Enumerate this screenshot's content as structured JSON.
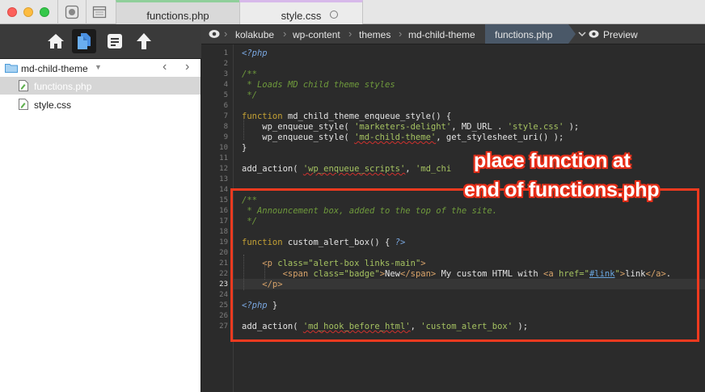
{
  "window": {
    "tabs": [
      {
        "label": "functions.php",
        "active": true,
        "color": "#8fcf9a"
      },
      {
        "label": "style.css",
        "active": false,
        "color": "#d7b9ea"
      }
    ]
  },
  "toolbar": {
    "icons": [
      "home-icon",
      "files-icon",
      "document-icon",
      "upload-arrow-icon"
    ]
  },
  "sidebar": {
    "project": "md-child-theme",
    "files": [
      {
        "label": "functions.php",
        "selected": true
      },
      {
        "label": "style.css",
        "selected": false
      }
    ]
  },
  "breadcrumb": {
    "items": [
      "kolakube",
      "wp-content",
      "themes",
      "md-child-theme",
      "functions.php"
    ],
    "preview_label": "Preview"
  },
  "editor": {
    "active_line": 23,
    "lines": [
      {
        "n": "1"
      },
      {
        "n": "2"
      },
      {
        "n": "3"
      },
      {
        "n": "4"
      },
      {
        "n": "5"
      },
      {
        "n": "6"
      },
      {
        "n": "7"
      },
      {
        "n": "8"
      },
      {
        "n": "9"
      },
      {
        "n": "10"
      },
      {
        "n": "11"
      },
      {
        "n": "12"
      },
      {
        "n": "13"
      },
      {
        "n": "14"
      },
      {
        "n": "15"
      },
      {
        "n": "16"
      },
      {
        "n": "17"
      },
      {
        "n": "18"
      },
      {
        "n": "19"
      },
      {
        "n": "20"
      },
      {
        "n": "21"
      },
      {
        "n": "22"
      },
      {
        "n": "23"
      },
      {
        "n": "24"
      },
      {
        "n": "25"
      },
      {
        "n": "26"
      },
      {
        "n": "27"
      }
    ],
    "code": {
      "l1": "<?php",
      "l3": "/**",
      "l4": " * Loads MD child theme styles",
      "l5": " */",
      "l7_kw": "function",
      "l7_fn": " md_child_theme_enqueue_style() {",
      "l8_a": "    wp_enqueue_style( ",
      "l8_s1": "'marketers-delight'",
      "l8_b": ", MD_URL . ",
      "l8_s2": "'style.css'",
      "l8_c": " );",
      "l9_a": "    wp_enqueue_style( ",
      "l9_s1": "'md-child-theme'",
      "l9_b": ", get_stylesheet_uri() );",
      "l10": "}",
      "l12_a": "add_action( ",
      "l12_s1": "'wp_enqueue_scripts'",
      "l12_b": ", ",
      "l12_s2": "'md_chi",
      "l15": "/**",
      "l16": " * Announcement box, added to the top of the site.",
      "l17": " */",
      "l19_kw": "function",
      "l19_fn": " custom_alert_box() { ",
      "l19_php": "?>",
      "l21_t1": "    <p ",
      "l21_attr": "class=\"alert-box links-main\"",
      "l21_t2": ">",
      "l22_t1": "        <span ",
      "l22_attr": "class=\"badge\"",
      "l22_t2": ">",
      "l22_txt1": "New",
      "l22_t3": "</span>",
      "l22_txt2": " My custom HTML with ",
      "l22_t4": "<a ",
      "l22_attr2": "href=\"",
      "l22_link": "#link",
      "l22_attr3": "\"",
      "l22_t5": ">",
      "l22_txt3": "link",
      "l22_t6": "</a>",
      "l22_txt4": ".",
      "l23_t1": "    </p>",
      "l25_php": "<?php",
      "l25_b": " }",
      "l27_a": "add_action( ",
      "l27_s1": "'md_hook_before_html'",
      "l27_b": ", ",
      "l27_s2": "'custom_alert_box'",
      "l27_c": " );"
    }
  },
  "annotation": {
    "line1": "place function at",
    "line2": "end of functions.php",
    "color": "#ef3a1f"
  }
}
